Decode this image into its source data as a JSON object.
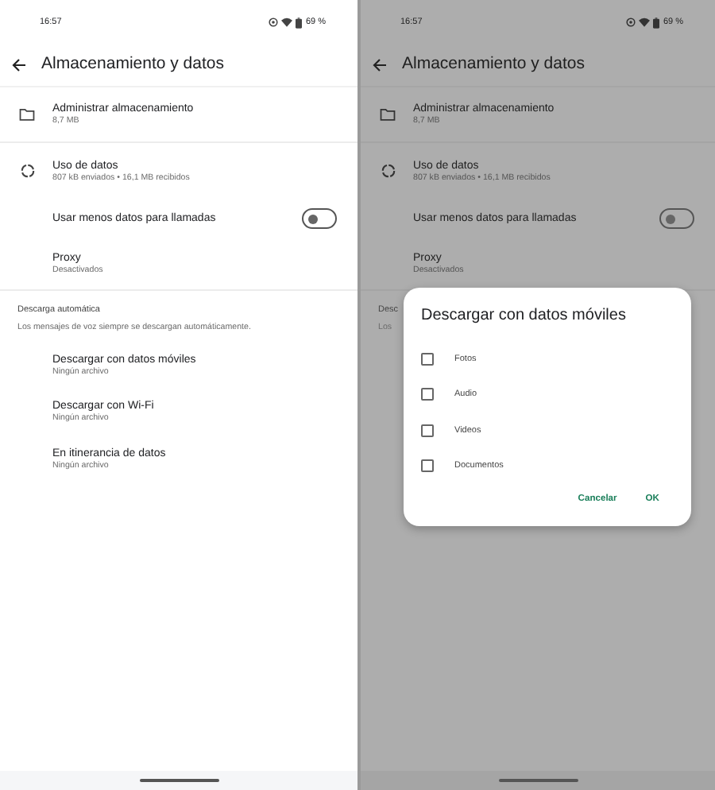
{
  "screens": [
    {
      "status_bar": {
        "time": "16:57",
        "battery": "69 %"
      },
      "title": "Almacenamiento y datos",
      "items": [
        {
          "kind": "nav",
          "title": "Administrar almacenamiento",
          "subtitle": "8,7 MB"
        },
        {
          "kind": "nav",
          "title": "Uso de datos",
          "subtitle": "807 kB enviados • 16,1 MB recibidos"
        },
        {
          "kind": "toggle",
          "title": "Usar menos datos para llamadas",
          "on": false
        },
        {
          "kind": "nav",
          "title": "Proxy",
          "subtitle": "Desactivados"
        },
        {
          "kind": "header",
          "title": "Descarga automática",
          "subtitle": "Los mensajes de voz siempre se descargan automáticamente."
        },
        {
          "kind": "nav",
          "title": "Descargar con datos móviles",
          "subtitle": "Ningún archivo"
        },
        {
          "kind": "nav",
          "title": "Descargar con Wi-Fi",
          "subtitle": "Ningún archivo"
        },
        {
          "kind": "nav",
          "title": "En itinerancia de datos",
          "subtitle": "Ningún archivo"
        }
      ]
    },
    {
      "status_bar": {
        "time": "16:57",
        "battery": "69 %"
      },
      "title": "Almacenamiento y datos",
      "items": [
        {
          "kind": "nav",
          "title": "Administrar almacenamiento",
          "subtitle": "8,7 MB"
        },
        {
          "kind": "nav",
          "title": "Uso de datos",
          "subtitle": "807 kB enviados • 16,1 MB recibidos"
        },
        {
          "kind": "toggle",
          "title": "Usar menos datos para llamadas",
          "on": false
        },
        {
          "kind": "nav",
          "title": "Proxy",
          "subtitle": "Desactivados"
        },
        {
          "kind": "header",
          "title": "Desc",
          "subtitle": "Los"
        }
      ],
      "dialog": {
        "title": "Descargar con datos móviles",
        "options": [
          {
            "label": "Fotos",
            "checked": false
          },
          {
            "label": "Audio",
            "checked": false
          },
          {
            "label": "Videos",
            "checked": false
          },
          {
            "label": "Documentos",
            "checked": false
          }
        ],
        "buttons": [
          "Cancelar",
          "OK"
        ]
      }
    }
  ]
}
